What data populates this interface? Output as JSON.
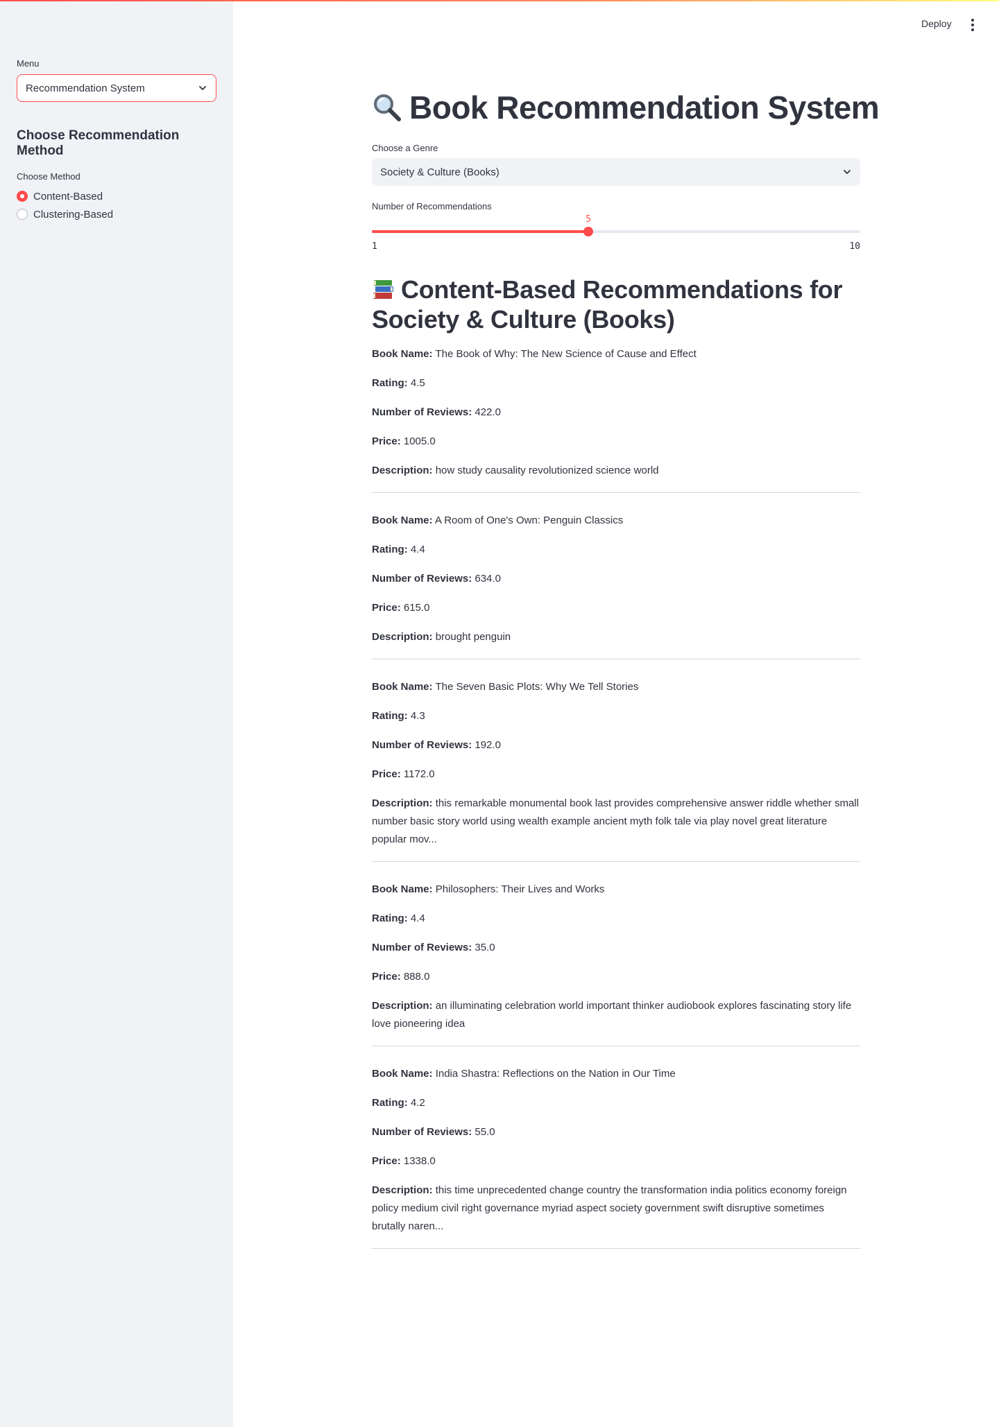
{
  "header": {
    "deploy_label": "Deploy"
  },
  "sidebar": {
    "menu_label": "Menu",
    "menu_value": "Recommendation System",
    "heading": "Choose Recommendation Method",
    "method_label": "Choose Method",
    "methods": [
      {
        "label": "Content-Based",
        "selected": true
      },
      {
        "label": "Clustering-Based",
        "selected": false
      }
    ]
  },
  "main": {
    "title": "Book Recommendation System",
    "genre_label": "Choose a Genre",
    "genre_value": "Society & Culture (Books)",
    "slider": {
      "label": "Number of Recommendations",
      "value": 5,
      "min": 1,
      "max": 10,
      "value_text": "5",
      "min_text": "1",
      "max_text": "10"
    },
    "results_heading": "Content-Based Recommendations for Society & Culture (Books)",
    "field_labels": {
      "name": "Book Name:",
      "rating": "Rating:",
      "reviews": "Number of Reviews:",
      "price": "Price:",
      "description": "Description:"
    },
    "books": [
      {
        "name": "The Book of Why: The New Science of Cause and Effect",
        "rating": "4.5",
        "reviews": "422.0",
        "price": "1005.0",
        "description": "how study causality revolutionized science world"
      },
      {
        "name": "A Room of One's Own: Penguin Classics",
        "rating": "4.4",
        "reviews": "634.0",
        "price": "615.0",
        "description": "brought penguin"
      },
      {
        "name": "The Seven Basic Plots: Why We Tell Stories",
        "rating": "4.3",
        "reviews": "192.0",
        "price": "1172.0",
        "description": "this remarkable monumental book last provides comprehensive answer riddle whether small number basic story world using wealth example ancient myth folk tale via play novel great literature popular mov..."
      },
      {
        "name": "Philosophers: Their Lives and Works",
        "rating": "4.4",
        "reviews": "35.0",
        "price": "888.0",
        "description": "an illuminating celebration world important thinker audiobook explores fascinating story life love pioneering idea"
      },
      {
        "name": "India Shastra: Reflections on the Nation in Our Time",
        "rating": "4.2",
        "reviews": "55.0",
        "price": "1338.0",
        "description": "this time unprecedented change country the transformation india politics economy foreign policy medium civil right governance myriad aspect society government swift disruptive sometimes brutally naren..."
      }
    ]
  },
  "colors": {
    "accent": "#ff4b4b",
    "sidebar_bg": "#f0f2f6",
    "text": "#31333f"
  },
  "icons": {
    "title": "magnifying-glass-icon",
    "results": "books-icon"
  }
}
